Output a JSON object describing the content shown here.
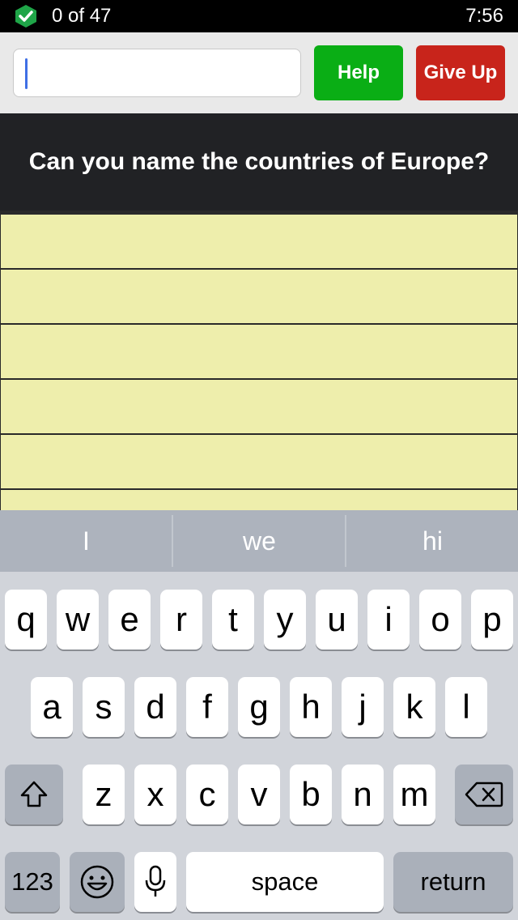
{
  "status_bar": {
    "score": "0 of 47",
    "time": "7:56",
    "badge_icon": "check-shield-icon"
  },
  "toolbar": {
    "answer_value": "",
    "help_label": "Help",
    "give_up_label": "Give Up"
  },
  "question": {
    "text": "Can you name the countries of Europe?"
  },
  "answers": {
    "visible_rows": 6
  },
  "keyboard": {
    "suggestions": [
      "I",
      "we",
      "hi"
    ],
    "row1": [
      "q",
      "w",
      "e",
      "r",
      "t",
      "y",
      "u",
      "i",
      "o",
      "p"
    ],
    "row2": [
      "a",
      "s",
      "d",
      "f",
      "g",
      "h",
      "j",
      "k",
      "l"
    ],
    "row3": [
      "z",
      "x",
      "c",
      "v",
      "b",
      "n",
      "m"
    ],
    "numbers_label": "123",
    "space_label": "space",
    "return_label": "return"
  },
  "colors": {
    "help": "#0aae15",
    "give_up": "#c8241b",
    "answer_row": "#eeeeac",
    "question_bg": "#212225"
  }
}
